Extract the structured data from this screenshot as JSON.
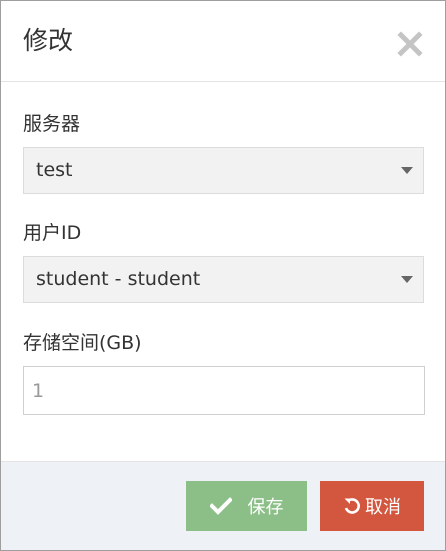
{
  "dialog": {
    "title": "修改",
    "close_icon": "close-icon"
  },
  "form": {
    "server": {
      "label": "服务器",
      "value": "test"
    },
    "user_id": {
      "label": "用户ID",
      "value": "student - student"
    },
    "storage": {
      "label": "存储空间(GB)",
      "value": "1"
    }
  },
  "footer": {
    "save_label": "保存",
    "save_icon": "check-icon",
    "cancel_label": "取消",
    "cancel_icon": "undo-icon"
  },
  "colors": {
    "save_button": "#8bbf87",
    "cancel_button": "#d3573e",
    "footer_background": "#eef1f5",
    "select_background": "#f2f2f2"
  }
}
